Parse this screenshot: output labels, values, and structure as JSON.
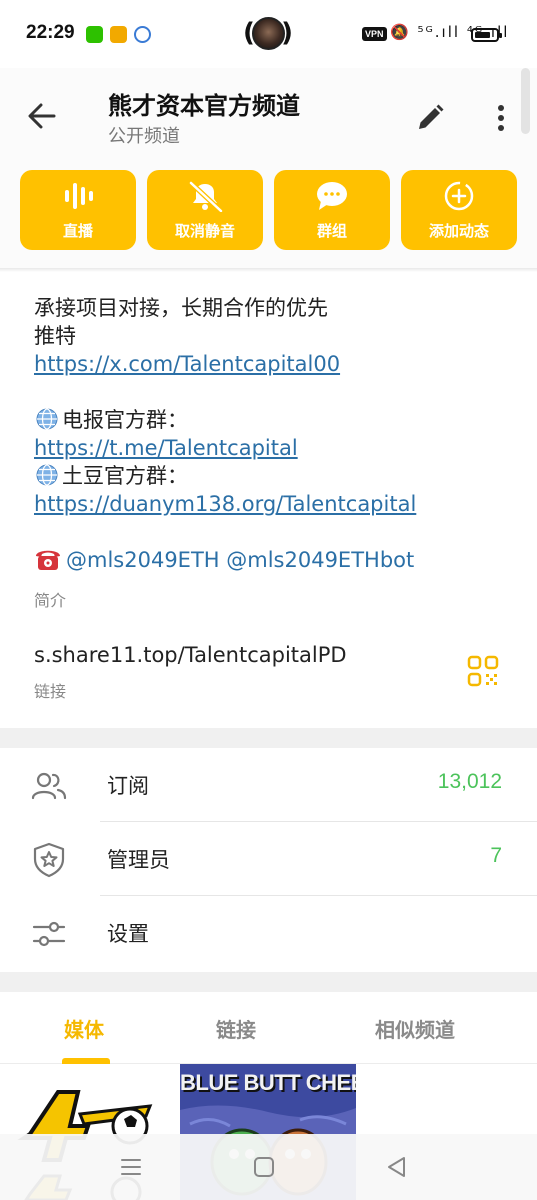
{
  "status_bar": {
    "time": "22:29",
    "vpn_label": "VPN",
    "network_icons": "🔕 ⁵ᴳ.ıll ⁴ᴳ.ıll"
  },
  "header": {
    "title": "熊才资本官方频道",
    "subtitle": "公开频道",
    "back_icon": "arrow-left",
    "edit_icon": "pencil",
    "more_icon": "dots-vertical"
  },
  "actions": [
    {
      "label": "直播",
      "icon": "live-wave"
    },
    {
      "label": "取消静音",
      "icon": "bell-off"
    },
    {
      "label": "群组",
      "icon": "chat-bubble"
    },
    {
      "label": "添加动态",
      "icon": "plus-circle"
    }
  ],
  "about": {
    "line1": "承接项目对接，长期合作的优先",
    "line2": "推特",
    "twitter_link": "https://x.com/Talentcapital00",
    "telegram_label": "电报官方群：",
    "telegram_link": "https://t.me/Talentcapital",
    "potato_label": "土豆官方群：",
    "potato_link": "https://duanym138.org/Talentcapital",
    "handle1": "@mls2049ETH",
    "handle2": "@mls2049ETHbot",
    "caption": "简介"
  },
  "link_section": {
    "value": "s.share11.top/TalentcapitalPD",
    "caption": "链接"
  },
  "info_rows": [
    {
      "label": "订阅",
      "value": "13,012",
      "icon": "people"
    },
    {
      "label": "管理员",
      "value": "7",
      "icon": "shield-star"
    },
    {
      "label": "设置",
      "value": "",
      "icon": "sliders"
    }
  ],
  "tabs": [
    {
      "label": "媒体",
      "active": true
    },
    {
      "label": "链接",
      "active": false
    },
    {
      "label": "相似频道",
      "active": false
    }
  ],
  "media": {
    "item2_text": "BLUE BUTT CHEES"
  },
  "colors": {
    "accent": "#ffc100",
    "link": "#2b6fa6",
    "count": "#4cc35b"
  }
}
